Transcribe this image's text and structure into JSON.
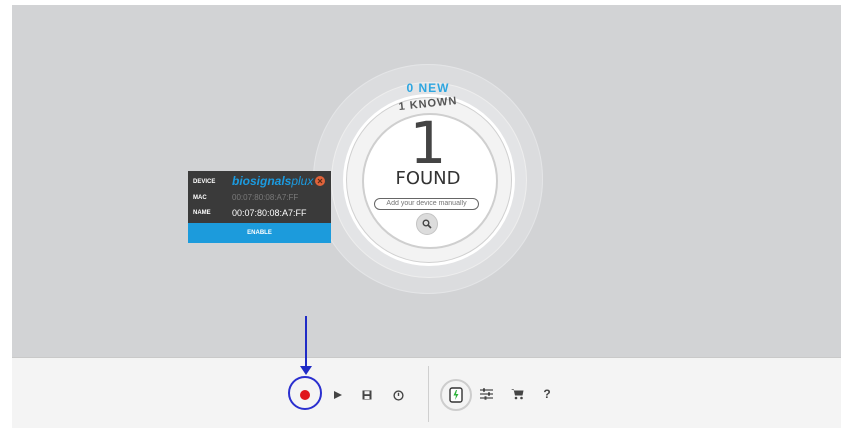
{
  "finder": {
    "new_label": "0 NEW",
    "known_label": "1 KNOWN",
    "count": "1",
    "found_label": "FOUND",
    "manual_placeholder": "Add your device manually"
  },
  "device_card": {
    "device_label": "DEVICE",
    "brand_text": "biosignals",
    "brand_suffix": "plux",
    "mac_label": "MAC",
    "mac_value": "00:07:80:08:A7:FF",
    "name_label": "NAME",
    "name_value": "00:07:80:08:A7:FF",
    "enable_label": "ENABLE"
  },
  "toolbar": {
    "help_label": "?"
  },
  "colors": {
    "accent_blue": "#1c9bdc",
    "new_blue": "#2ea6e0",
    "record_red": "#e0161c",
    "annotation_blue": "#1f2bc6",
    "close_orange": "#e0633a"
  },
  "icons": [
    "search-icon",
    "close-icon",
    "record-icon",
    "play-icon",
    "save-icon",
    "power-icon",
    "device-icon",
    "sliders-icon",
    "cart-icon",
    "help-icon"
  ]
}
